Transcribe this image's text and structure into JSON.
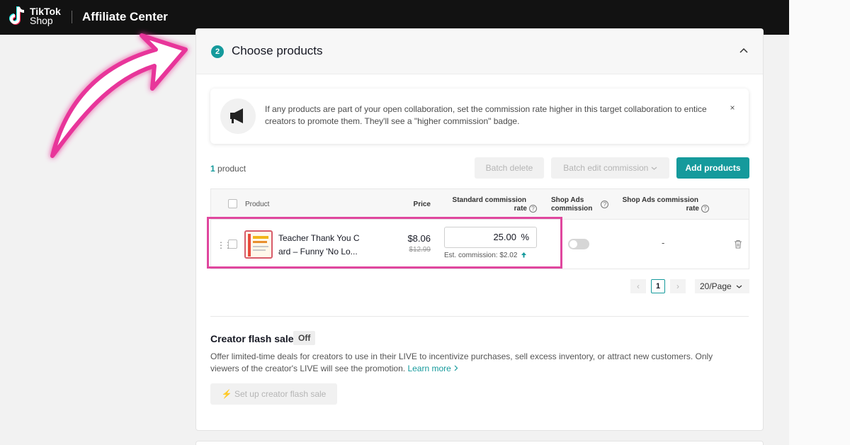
{
  "topbar": {
    "logo_line1": "TikTok",
    "logo_line2": "Shop",
    "title": "Affiliate Center"
  },
  "section": {
    "step": "2",
    "title": "Choose products"
  },
  "notice": {
    "text": "If any products are part of your open collaboration, set the commission rate higher in this target collaboration to entice creators to promote them. They'll see a \"higher commission\" badge.",
    "close": "×"
  },
  "toolbar": {
    "count_num": "1",
    "count_label": " product",
    "batch_delete": "Batch delete",
    "batch_edit": "Batch edit commission",
    "add_products": "Add products"
  },
  "table": {
    "headers": {
      "product": "Product",
      "price": "Price",
      "std_commission_1": "Standard commission",
      "std_commission_2": "rate",
      "shop_ads_1": "Shop Ads",
      "shop_ads_2": "commission",
      "shop_ads_rate_1": "Shop Ads commission",
      "shop_ads_rate_2": "rate"
    },
    "rows": [
      {
        "name_line1": "Teacher Thank You C",
        "name_line2": "ard – Funny 'No Lo...",
        "price": "$8.06",
        "old_price": "$12.99",
        "rate": "25.00",
        "rate_unit": "%",
        "est_commission": "Est. commission: $2.02",
        "shop_ads_rate": "-"
      }
    ]
  },
  "pagination": {
    "current": "1",
    "page_size": "20/Page"
  },
  "flash_sale": {
    "title": "Creator flash sale",
    "status": "Off",
    "description": "Offer limited-time deals for creators to use in their LIVE to incentivize purchases, sell excess inventory, or attract new customers. Only viewers of the creator's LIVE will see the promotion.",
    "learn_more": "Learn more",
    "setup_button": "Set up creator flash sale"
  },
  "colors": {
    "accent": "#159a9c",
    "highlight": "#e0479e",
    "topbar": "#121212"
  }
}
